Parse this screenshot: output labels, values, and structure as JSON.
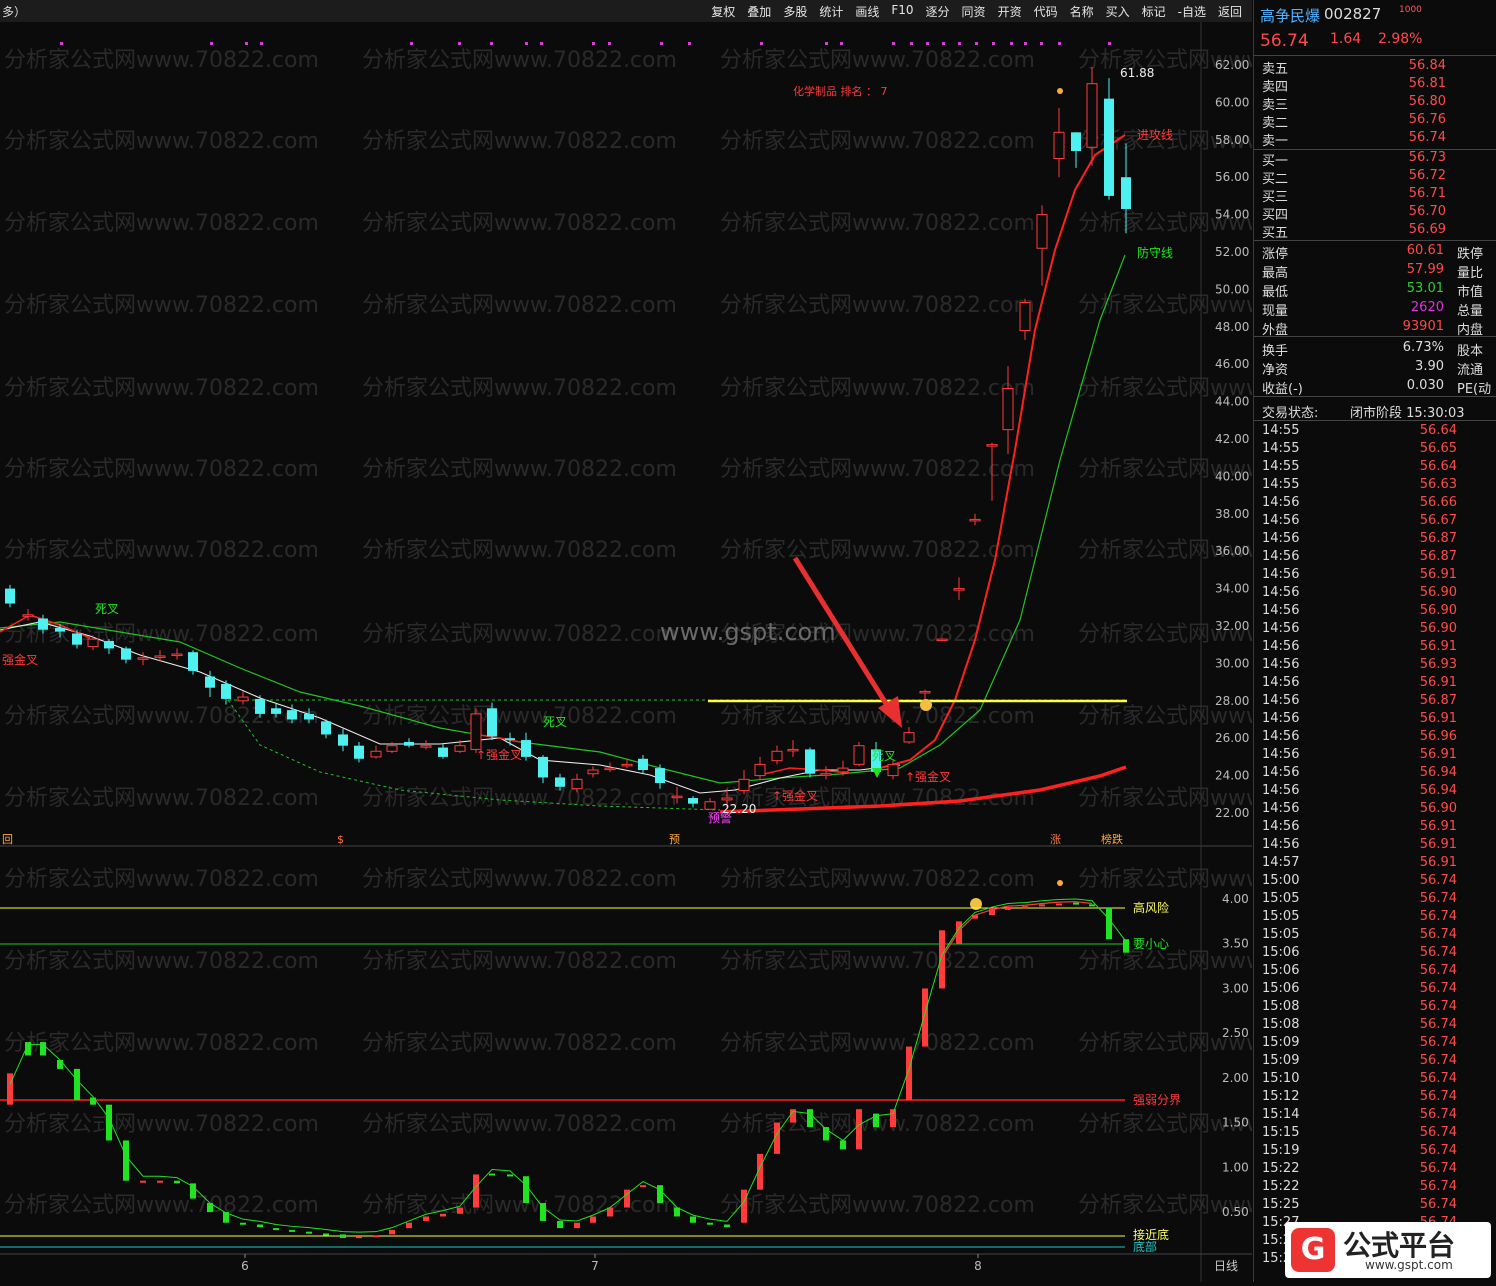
{
  "toolbar": {
    "left_label": "多）",
    "buttons": [
      "复权",
      "叠加",
      "多股",
      "统计",
      "画线",
      "F10",
      "逐分",
      "同资",
      "开资",
      "代码",
      "名称",
      "买入",
      "标记",
      "-自选",
      "返回"
    ]
  },
  "chart": {
    "sector_label": "化学制品  排名 ：  7",
    "price_ticks": [
      "62.00",
      "60.00",
      "58.00",
      "56.00",
      "54.00",
      "52.00",
      "50.00",
      "48.00",
      "46.00",
      "44.00",
      "42.00",
      "40.00",
      "38.00",
      "36.00",
      "34.00",
      "32.00",
      "30.00",
      "28.00",
      "26.00",
      "24.00",
      "22.00"
    ],
    "indicator_ticks": [
      "4.00",
      "3.50",
      "3.00",
      "2.50",
      "2.00",
      "1.50",
      "1.00",
      "0.50"
    ],
    "date_ticks": [
      "6",
      "7",
      "8"
    ],
    "period_label": "日线",
    "high_label": "61.88",
    "low_label": "22.20",
    "attack_line_label": "进攻线",
    "defense_line_label": "防守线",
    "high_risk_label": "高风险",
    "caution_label": "要小心",
    "strong_weak_label": "强弱分界",
    "near_bottom_label": "接近底",
    "bottom_label": "底部",
    "annotations": {
      "dead_cross_1": "死叉",
      "dead_cross_2": "死叉",
      "golden_cross": "强金叉",
      "warning": "预警",
      "marker_hui": "回",
      "marker_yu": "预",
      "marker_zhang": "涨",
      "marker_bang": "榜跌"
    },
    "watermark": "分析家公式网www.70822.com",
    "center_watermark": "www.gspt.com",
    "logo_text": "公式平台",
    "logo_url": "www.gspt.com",
    "colors": {
      "up": "#ff3b3b",
      "down": "#4ff0f0",
      "attack": "#ff2020",
      "defense": "#22c322",
      "yellow": "#ffff33"
    }
  },
  "side": {
    "stock_name": "高争民爆",
    "stock_code": "002827",
    "price": "56.74",
    "change": "1.64",
    "change_pct": "2.98%",
    "asks": [
      {
        "label": "卖五",
        "price": "56.84"
      },
      {
        "label": "卖四",
        "price": "56.81"
      },
      {
        "label": "卖三",
        "price": "56.80"
      },
      {
        "label": "卖二",
        "price": "56.76"
      },
      {
        "label": "卖一",
        "price": "56.74"
      }
    ],
    "bids": [
      {
        "label": "买一",
        "price": "56.73"
      },
      {
        "label": "买二",
        "price": "56.72"
      },
      {
        "label": "买三",
        "price": "56.71"
      },
      {
        "label": "买四",
        "price": "56.70"
      },
      {
        "label": "买五",
        "price": "56.69"
      }
    ],
    "stats": [
      {
        "label": "涨停",
        "value": "60.61",
        "color": "#ff4a4a",
        "right": "跌停"
      },
      {
        "label": "最高",
        "value": "57.99",
        "color": "#ff4a4a",
        "right": "量比"
      },
      {
        "label": "最低",
        "value": "53.01",
        "color": "#33cc33",
        "right": "市值"
      },
      {
        "label": "现量",
        "value": "2620",
        "color": "#dd33dd",
        "right": "总量"
      },
      {
        "label": "外盘",
        "value": "93901",
        "color": "#ff4a4a",
        "right": "内盘"
      }
    ],
    "stats2": [
      {
        "label": "换手",
        "value": "6.73%",
        "right": "股本"
      },
      {
        "label": "净资",
        "value": "3.90",
        "right": "流通"
      },
      {
        "label": "收益(-)",
        "value": "0.030",
        "right": "PE(动"
      }
    ],
    "trade_status_label": "交易状态:",
    "trade_status": "闭市阶段 15:30:03",
    "ticks": [
      [
        "14:55",
        "56.64"
      ],
      [
        "14:55",
        "56.65"
      ],
      [
        "14:55",
        "56.64"
      ],
      [
        "14:55",
        "56.63"
      ],
      [
        "14:56",
        "56.66"
      ],
      [
        "14:56",
        "56.67"
      ],
      [
        "14:56",
        "56.87"
      ],
      [
        "14:56",
        "56.87"
      ],
      [
        "14:56",
        "56.91"
      ],
      [
        "14:56",
        "56.90"
      ],
      [
        "14:56",
        "56.90"
      ],
      [
        "14:56",
        "56.90"
      ],
      [
        "14:56",
        "56.91"
      ],
      [
        "14:56",
        "56.93"
      ],
      [
        "14:56",
        "56.91"
      ],
      [
        "14:56",
        "56.87"
      ],
      [
        "14:56",
        "56.91"
      ],
      [
        "14:56",
        "56.96"
      ],
      [
        "14:56",
        "56.91"
      ],
      [
        "14:56",
        "56.94"
      ],
      [
        "14:56",
        "56.94"
      ],
      [
        "14:56",
        "56.90"
      ],
      [
        "14:56",
        "56.91"
      ],
      [
        "14:56",
        "56.91"
      ],
      [
        "14:57",
        "56.91"
      ],
      [
        "15:00",
        "56.74"
      ],
      [
        "15:05",
        "56.74"
      ],
      [
        "15:05",
        "56.74"
      ],
      [
        "15:05",
        "56.74"
      ],
      [
        "15:06",
        "56.74"
      ],
      [
        "15:06",
        "56.74"
      ],
      [
        "15:06",
        "56.74"
      ],
      [
        "15:08",
        "56.74"
      ],
      [
        "15:08",
        "56.74"
      ],
      [
        "15:09",
        "56.74"
      ],
      [
        "15:09",
        "56.74"
      ],
      [
        "15:10",
        "56.74"
      ],
      [
        "15:12",
        "56.74"
      ],
      [
        "15:14",
        "56.74"
      ],
      [
        "15:15",
        "56.74"
      ],
      [
        "15:19",
        "56.74"
      ],
      [
        "15:22",
        "56.74"
      ],
      [
        "15:22",
        "56.74"
      ],
      [
        "15:25",
        "56.74"
      ],
      [
        "15:27",
        "56.74"
      ],
      [
        "15:27",
        "56.74"
      ],
      [
        "15:27",
        "56.74"
      ]
    ]
  }
}
